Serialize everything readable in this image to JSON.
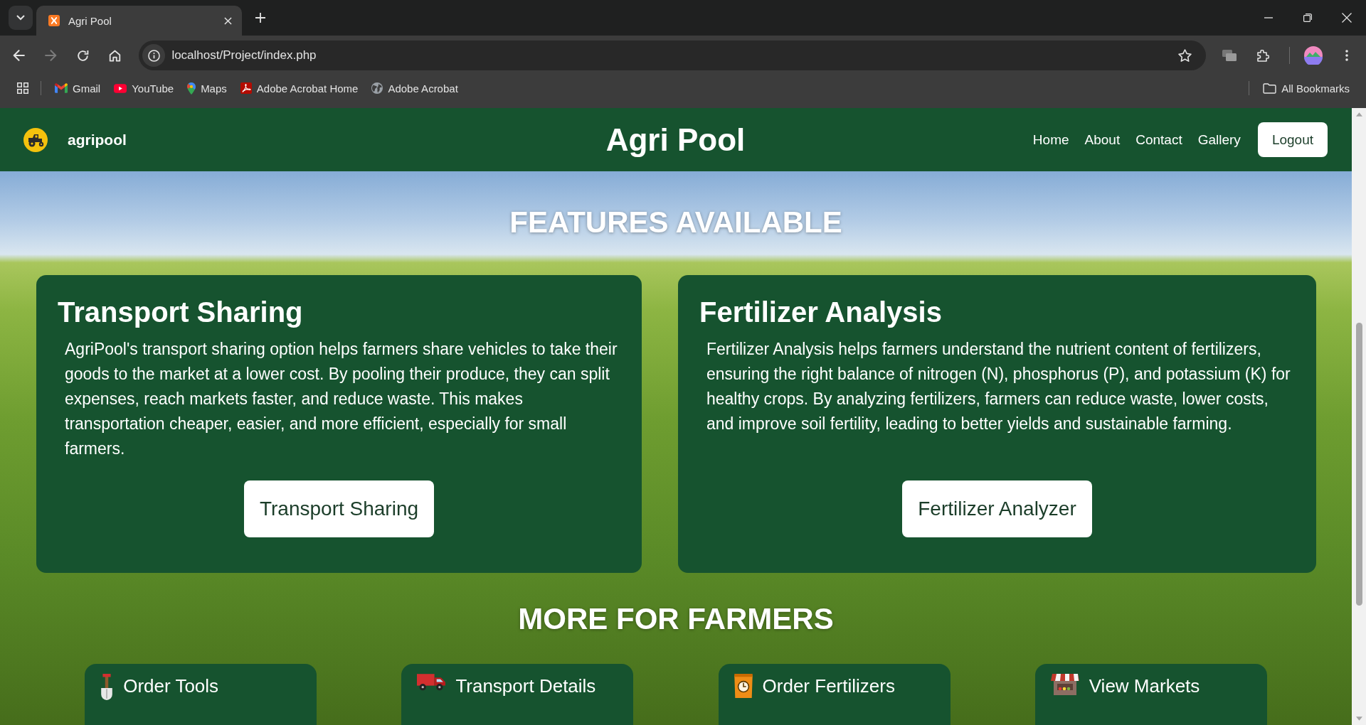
{
  "browser": {
    "tabs": [
      {
        "title": "Agri Pool",
        "selected": true
      }
    ],
    "nav_buttons": [
      {
        "kind": "back",
        "disabled": false
      },
      {
        "kind": "forward",
        "disabled": true
      },
      {
        "kind": "reload",
        "disabled": false
      },
      {
        "kind": "home",
        "disabled": false
      }
    ],
    "address": "localhost/Project/index.php",
    "bookmarks": [
      {
        "kind": "gmail",
        "label": "Gmail"
      },
      {
        "kind": "youtube",
        "label": "YouTube"
      },
      {
        "kind": "maps",
        "label": "Maps"
      },
      {
        "kind": "acrobat",
        "label": "Adobe Acrobat Home"
      },
      {
        "kind": "globe",
        "label": "Adobe Acrobat"
      }
    ],
    "all_bookmarks": "All Bookmarks"
  },
  "navbar": {
    "brand": "agripool",
    "title": "Agri Pool",
    "links": [
      "Home",
      "About",
      "Contact",
      "Gallery"
    ],
    "logout": "Logout"
  },
  "features": {
    "heading": "FEATURES AVAILABLE",
    "cards": [
      {
        "title": "Transport Sharing",
        "text": "AgriPool's transport sharing option helps farmers share vehicles to take their goods to the market at a lower cost. By pooling their produce, they can split expenses, reach markets faster, and reduce waste. This makes transportation cheaper, easier, and more efficient, especially for small farmers.",
        "button": "Transport Sharing"
      },
      {
        "title": "Fertilizer Analysis",
        "text": "Fertilizer Analysis helps farmers understand the nutrient content of fertilizers, ensuring the right balance of nitrogen (N), phosphorus (P), and potassium (K) for healthy crops. By analyzing fertilizers, farmers can reduce waste, lower costs, and improve soil fertility, leading to better yields and sustainable farming.",
        "button": "Fertilizer Analyzer"
      }
    ]
  },
  "more": {
    "heading": "MORE FOR FARMERS",
    "items": [
      {
        "kind": "tools",
        "label": "Order Tools"
      },
      {
        "kind": "transport",
        "label": "Transport Details"
      },
      {
        "kind": "fertilizer",
        "label": "Order Fertilizers"
      },
      {
        "kind": "market",
        "label": "View Markets"
      }
    ]
  }
}
